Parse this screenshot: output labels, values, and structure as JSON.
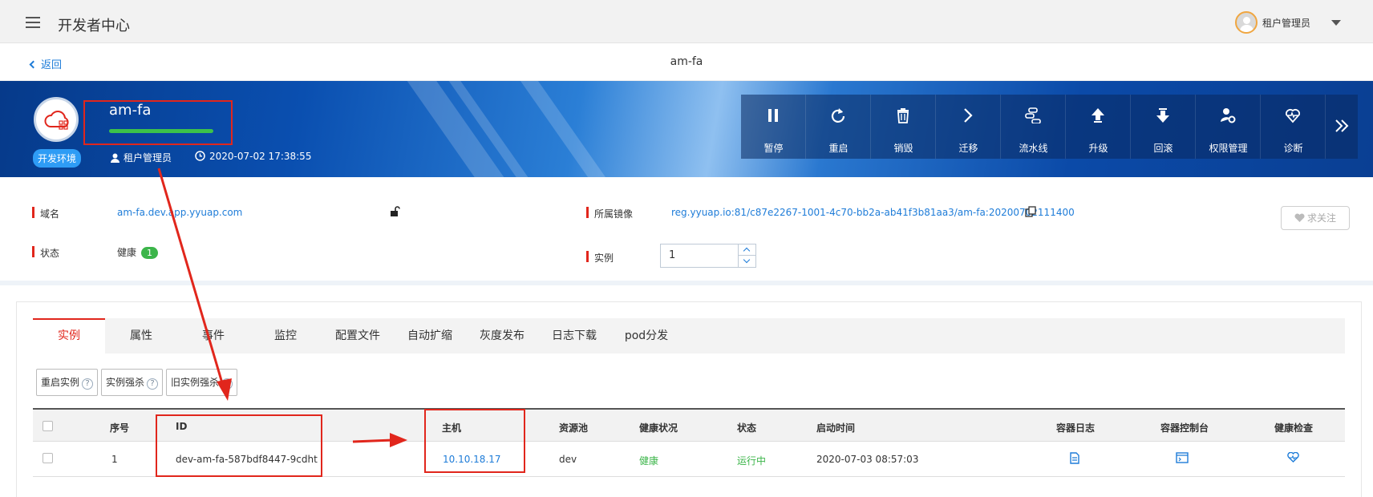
{
  "header": {
    "app_title": "开发者中心",
    "user_name": "租户管理员"
  },
  "nav": {
    "back_label": "返回",
    "page_title": "am-fa"
  },
  "app": {
    "name": "am-fa",
    "environment": "开发环境",
    "owner": "租户管理员",
    "created_at": "2020-07-02 17:38:55",
    "health_level": 1.0,
    "toolbar": [
      "暂停",
      "重启",
      "销毁",
      "迁移",
      "流水线",
      "升级",
      "回滚",
      "权限管理",
      "诊断"
    ]
  },
  "info": {
    "domain_label": "域名",
    "domain_value": "am-fa.dev.app.yyuap.com",
    "status_label": "状态",
    "status_value": "健康",
    "status_count": "1",
    "image_label": "所属镜像",
    "image_value": "reg.yyuap.io:81/c87e2267-1001-4c70-bb2a-ab41f3b81aa3/am-fa:20200702111400",
    "instance_label": "实例",
    "instance_value": "1",
    "follow_label": "求关注"
  },
  "tabs": [
    "实例",
    "属性",
    "事件",
    "监控",
    "配置文件",
    "自动扩缩",
    "灰度发布",
    "日志下载",
    "pod分发"
  ],
  "actions": [
    "重启实例",
    "实例强杀",
    "旧实例强杀"
  ],
  "table": {
    "headers": [
      "序号",
      "ID",
      "主机",
      "资源池",
      "健康状况",
      "状态",
      "启动时间",
      "容器日志",
      "容器控制台",
      "健康检查"
    ],
    "rows": [
      {
        "index": "1",
        "id": "dev-am-fa-587bdf8447-9cdht",
        "host": "10.10.18.17",
        "pool": "dev",
        "health": "健康",
        "status": "运行中",
        "started": "2020-07-03 08:57:03"
      }
    ]
  },
  "colors": {
    "accent": "#1e7cd8",
    "annotation": "#e1261c",
    "healthy": "#3cb54a"
  }
}
